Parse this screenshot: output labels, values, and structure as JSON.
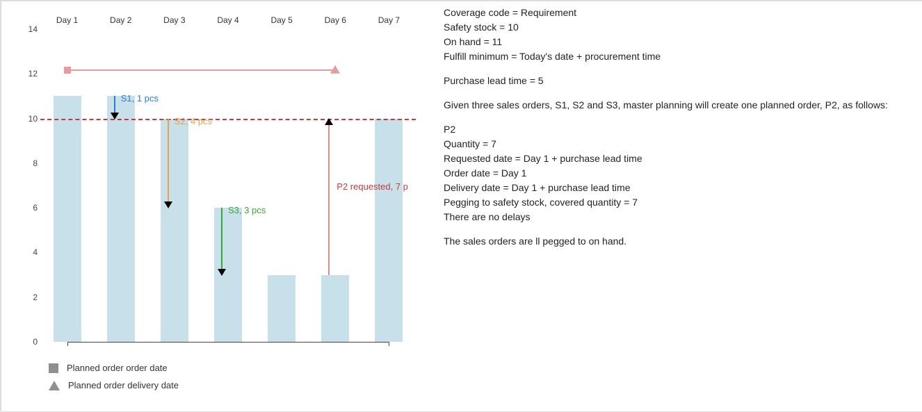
{
  "chart_data": {
    "type": "bar",
    "categories": [
      "Day 1",
      "Day 2",
      "Day 3",
      "Day 4",
      "Day 5",
      "Day 6",
      "Day 7"
    ],
    "values": [
      11,
      11,
      10,
      6,
      3,
      3,
      10
    ],
    "ylim": [
      0,
      14
    ],
    "yticks": [
      0,
      2,
      4,
      6,
      8,
      10,
      12,
      14
    ],
    "safety_stock_line": 10,
    "planned_order": {
      "order_day": 1,
      "delivery_day": 6,
      "quantity": 7,
      "label": "P2 requested, 7 p"
    },
    "sales_orders": [
      {
        "id": "S1",
        "day": 2,
        "qty": 1,
        "from": 11,
        "to": 10,
        "color": "#2a7bd6",
        "label": "S1, 1 pcs"
      },
      {
        "id": "S2",
        "day": 3,
        "qty": 4,
        "from": 10,
        "to": 6,
        "color": "#e8a24d",
        "label": "S2, 4 pcs"
      },
      {
        "id": "S3",
        "day": 4,
        "qty": 3,
        "from": 6,
        "to": 3,
        "color": "#3aa63a",
        "label": "S3, 3 pcs"
      }
    ],
    "legend": {
      "square": "Planned order order date",
      "triangle": "Planned order delivery date"
    }
  },
  "panel": {
    "l1": "Coverage code = Requirement",
    "l2": "Safety stock = 10",
    "l3": "On hand = 11",
    "l4": "Fulfill minimum = Today's date + procurement time",
    "l5": "Purchase lead time = 5",
    "l6": "Given three sales orders, S1, S2 and S3, master planning will create one planned order, P2, as follows:",
    "l7": "P2",
    "l8": "Quantity = 7",
    "l9": "Requested date = Day 1 + purchase lead time",
    "l10": "Order date = Day 1",
    "l11": "Delivery date = Day 1 + purchase lead time",
    "l12": "Pegging to safety stock, covered quantity = 7",
    "l13": "There are no delays",
    "l14": " The sales orders are ll pegged to on hand."
  }
}
